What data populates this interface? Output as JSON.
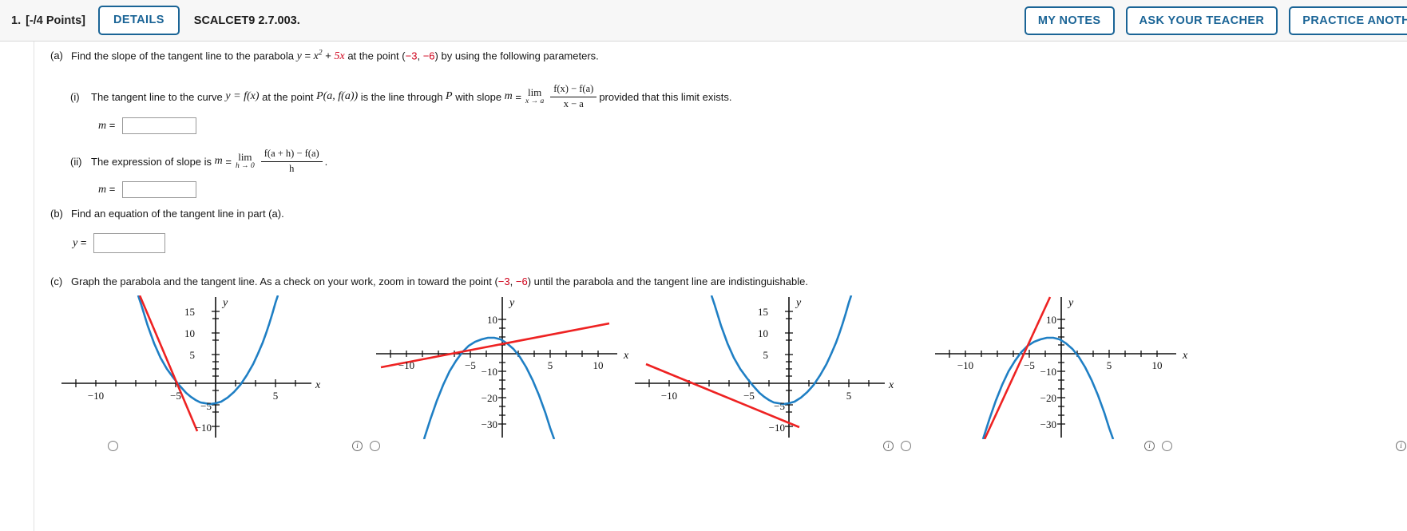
{
  "header": {
    "question_number": "1.",
    "points": "[-/4 Points]",
    "details_label": "DETAILS",
    "textbook_code": "SCALCET9 2.7.003.",
    "my_notes_label": "MY NOTES",
    "ask_teacher_label": "ASK YOUR TEACHER",
    "practice_label": "PRACTICE ANOTHER",
    "accent_color": "#1a6496",
    "bar_bg": "#f7f7f7"
  },
  "parts": {
    "a": {
      "label": "(a)",
      "text_1": "Find the slope of the tangent line to the parabola",
      "eq_y": "y",
      "eq_eq": "=",
      "eq_x": "x",
      "eq_exp": "2",
      "eq_plus": "+",
      "eq_5x": "5x",
      "text_2": "at the point",
      "point_open": "(",
      "point_x": "−3",
      "point_comma": ",",
      "point_y": "−6",
      "point_close": ")",
      "text_3": "by using the following parameters.",
      "sub_i": {
        "label": "(i)",
        "text_1": "The tangent line to the curve",
        "fx": "y = f(x)",
        "text_2": "at the point",
        "pt": "P(a, f(a))",
        "text_3": "is the line through",
        "p": "P",
        "text_4": "with slope",
        "m": "m",
        "eq": "=",
        "lim": "lim",
        "lim_sub": "x → a",
        "frac_num": "f(x) − f(a)",
        "frac_den": "x − a",
        "text_5": "provided that this limit exists.",
        "m_label": "m",
        "m_eq": "=",
        "m_value": ""
      },
      "sub_ii": {
        "label": "(ii)",
        "text_1": "The expression of slope is",
        "m": "m",
        "eq": "=",
        "lim": "lim",
        "lim_sub": "h → 0",
        "frac_num": "f(a + h) − f(a)",
        "frac_den": "h",
        "period": ".",
        "m_label": "m",
        "m_eq": "=",
        "m_value": ""
      }
    },
    "b": {
      "label": "(b)",
      "text": "Find an equation of the tangent line in part (a).",
      "y_label": "y",
      "y_eq": "=",
      "y_value": ""
    },
    "c": {
      "label": "(c)",
      "text_1": "Graph the parabola and the tangent line. As a check on your work, zoom in toward the point",
      "point_open": "(",
      "point_x": "−3",
      "point_comma": ",",
      "point_y": "−6",
      "point_close": ")",
      "text_2": "until the parabola and the tangent line are indistinguishable."
    }
  },
  "chart_data": [
    {
      "type": "line",
      "id": "graph-option-1",
      "xlabel": "x",
      "ylabel": "y",
      "xticks": [
        -10,
        -5,
        5
      ],
      "yticks": [
        15,
        10,
        5,
        -5,
        -10
      ],
      "xlim": [
        -13.5,
        8.5
      ],
      "ylim": [
        -11,
        17
      ],
      "series": [
        {
          "name": "parabola",
          "color": "#1f7fc4",
          "kind": "parabola_up",
          "vertex": [
            -2.5,
            -6.25
          ],
          "a": 1
        },
        {
          "name": "tangent",
          "color": "#ee2222",
          "kind": "line",
          "slope": -7,
          "through": [
            -3,
            -6
          ]
        }
      ]
    },
    {
      "type": "line",
      "id": "graph-option-2",
      "xlabel": "x",
      "ylabel": "y",
      "xticks": [
        -10,
        -5,
        5,
        10
      ],
      "yticks": [
        10,
        -10,
        -20,
        -30
      ],
      "xlim": [
        -13.5,
        13.5
      ],
      "ylim": [
        -34,
        16
      ],
      "series": [
        {
          "name": "parabola",
          "color": "#1f7fc4",
          "kind": "parabola_down",
          "vertex": [
            -2.5,
            6.25
          ],
          "a": -1
        },
        {
          "name": "tangent",
          "color": "#ee2222",
          "kind": "line",
          "slope": 0.8,
          "through": [
            -3,
            6
          ]
        }
      ]
    },
    {
      "type": "line",
      "id": "graph-option-3",
      "xlabel": "x",
      "ylabel": "y",
      "xticks": [
        -10,
        -5,
        5
      ],
      "yticks": [
        15,
        10,
        5,
        -5,
        -10
      ],
      "xlim": [
        -13.5,
        8.5
      ],
      "ylim": [
        -11,
        17
      ],
      "series": [
        {
          "name": "parabola",
          "color": "#1f7fc4",
          "kind": "parabola_up",
          "vertex": [
            -2.5,
            -6.25
          ],
          "a": 1
        },
        {
          "name": "tangent",
          "color": "#ee2222",
          "kind": "line",
          "slope": -0.9,
          "through": [
            -6,
            -2
          ]
        }
      ]
    },
    {
      "type": "line",
      "id": "graph-option-4",
      "xlabel": "x",
      "ylabel": "y",
      "xticks": [
        -10,
        -5,
        5,
        10
      ],
      "yticks": [
        10,
        -10,
        -20,
        -30
      ],
      "xlim": [
        -13.5,
        13.5
      ],
      "ylim": [
        -34,
        16
      ],
      "series": [
        {
          "name": "parabola",
          "color": "#1f7fc4",
          "kind": "parabola_down",
          "vertex": [
            -2.5,
            6.25
          ],
          "a": -1
        },
        {
          "name": "tangent",
          "color": "#ee2222",
          "kind": "line",
          "slope": 7,
          "through": [
            -3,
            6
          ]
        }
      ]
    }
  ],
  "graph_options": [
    {
      "radio_selected": false,
      "info_label": "i"
    },
    {
      "radio_selected": false,
      "info_label": "i"
    },
    {
      "radio_selected": false,
      "info_label": "i"
    },
    {
      "radio_selected": false,
      "info_label": "i"
    }
  ]
}
